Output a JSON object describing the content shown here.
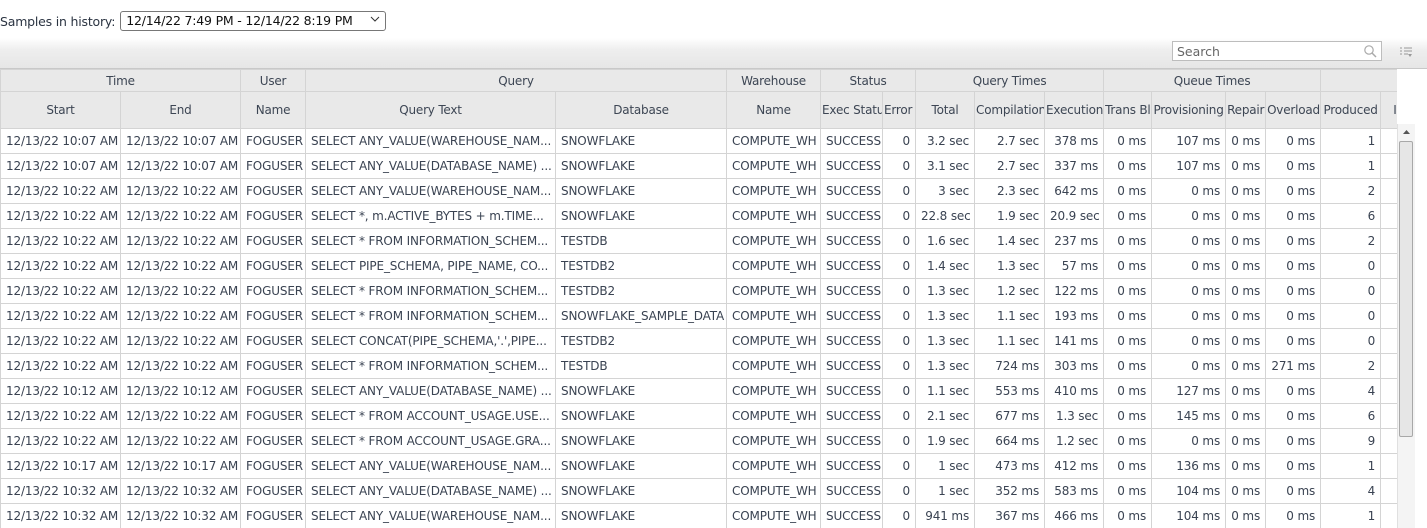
{
  "history": {
    "label": "Samples in history:",
    "selected": "12/14/22 7:49 PM - 12/14/22 8:19 PM"
  },
  "search": {
    "placeholder": "Search",
    "value": ""
  },
  "icons": {
    "search": "search-icon",
    "columns_menu": "column-chooser-icon",
    "dropdown": "chevron-down-icon",
    "scroll_up": "scroll-up-arrow-icon"
  },
  "grid": {
    "groups": [
      {
        "label": "Time",
        "span": 2
      },
      {
        "label": "User",
        "span": 1
      },
      {
        "label": "Query",
        "span": 2
      },
      {
        "label": "Warehouse",
        "span": 1
      },
      {
        "label": "Status",
        "span": 2
      },
      {
        "label": "Query Times",
        "span": 3
      },
      {
        "label": "Queue Times",
        "span": 4
      },
      {
        "label": "",
        "span": 2
      }
    ],
    "columns": [
      {
        "key": "start",
        "label": "Start",
        "align": "txt"
      },
      {
        "key": "end",
        "label": "End",
        "align": "txt"
      },
      {
        "key": "user",
        "label": "Name",
        "align": "txt"
      },
      {
        "key": "query",
        "label": "Query Text",
        "align": "txt"
      },
      {
        "key": "db",
        "label": "Database",
        "align": "txt"
      },
      {
        "key": "wh",
        "label": "Name",
        "align": "txt"
      },
      {
        "key": "exec",
        "label": "Exec Status",
        "align": "txt"
      },
      {
        "key": "err",
        "label": "Error Code",
        "align": "num"
      },
      {
        "key": "total",
        "label": "Total",
        "align": "num"
      },
      {
        "key": "comp",
        "label": "Compilation",
        "align": "num"
      },
      {
        "key": "execution",
        "label": "Execution",
        "align": "num"
      },
      {
        "key": "trans",
        "label": "Trans Blocked",
        "align": "num"
      },
      {
        "key": "prov",
        "label": "Provisioning",
        "align": "num"
      },
      {
        "key": "repair",
        "label": "Repair",
        "align": "num"
      },
      {
        "key": "overload",
        "label": "Overload",
        "align": "num"
      },
      {
        "key": "produced",
        "label": "Produced",
        "align": "num"
      },
      {
        "key": "ins",
        "label": "In:",
        "align": "num"
      }
    ],
    "rows": [
      {
        "start": "12/13/22 10:07 AM",
        "end": "12/13/22 10:07 AM",
        "user": "FOGUSER",
        "query": "SELECT ANY_VALUE(WAREHOUSE_NAM...",
        "db": "SNOWFLAKE",
        "wh": "COMPUTE_WH",
        "exec": "SUCCESS",
        "err": "0",
        "total": "3.2 sec",
        "comp": "2.7 sec",
        "execution": "378 ms",
        "trans": "0 ms",
        "prov": "107 ms",
        "repair": "0 ms",
        "overload": "0 ms",
        "produced": "1",
        "ins": ""
      },
      {
        "start": "12/13/22 10:07 AM",
        "end": "12/13/22 10:07 AM",
        "user": "FOGUSER",
        "query": "SELECT ANY_VALUE(DATABASE_NAME) ...",
        "db": "SNOWFLAKE",
        "wh": "COMPUTE_WH",
        "exec": "SUCCESS",
        "err": "0",
        "total": "3.1 sec",
        "comp": "2.7 sec",
        "execution": "337 ms",
        "trans": "0 ms",
        "prov": "107 ms",
        "repair": "0 ms",
        "overload": "0 ms",
        "produced": "1",
        "ins": ""
      },
      {
        "start": "12/13/22 10:22 AM",
        "end": "12/13/22 10:22 AM",
        "user": "FOGUSER",
        "query": "SELECT ANY_VALUE(WAREHOUSE_NAM...",
        "db": "SNOWFLAKE",
        "wh": "COMPUTE_WH",
        "exec": "SUCCESS",
        "err": "0",
        "total": "3 sec",
        "comp": "2.3 sec",
        "execution": "642 ms",
        "trans": "0 ms",
        "prov": "0 ms",
        "repair": "0 ms",
        "overload": "0 ms",
        "produced": "2",
        "ins": ""
      },
      {
        "start": "12/13/22 10:22 AM",
        "end": "12/13/22 10:22 AM",
        "user": "FOGUSER",
        "query": "SELECT *, m.ACTIVE_BYTES + m.TIME...",
        "db": "SNOWFLAKE",
        "wh": "COMPUTE_WH",
        "exec": "SUCCESS",
        "err": "0",
        "total": "22.8 sec",
        "comp": "1.9 sec",
        "execution": "20.9 sec",
        "trans": "0 ms",
        "prov": "0 ms",
        "repair": "0 ms",
        "overload": "0 ms",
        "produced": "6",
        "ins": ""
      },
      {
        "start": "12/13/22 10:22 AM",
        "end": "12/13/22 10:22 AM",
        "user": "FOGUSER",
        "query": "SELECT * FROM INFORMATION_SCHEM...",
        "db": "TESTDB",
        "wh": "COMPUTE_WH",
        "exec": "SUCCESS",
        "err": "0",
        "total": "1.6 sec",
        "comp": "1.4 sec",
        "execution": "237 ms",
        "trans": "0 ms",
        "prov": "0 ms",
        "repair": "0 ms",
        "overload": "0 ms",
        "produced": "2",
        "ins": ""
      },
      {
        "start": "12/13/22 10:22 AM",
        "end": "12/13/22 10:22 AM",
        "user": "FOGUSER",
        "query": "SELECT PIPE_SCHEMA, PIPE_NAME, CO...",
        "db": "TESTDB2",
        "wh": "COMPUTE_WH",
        "exec": "SUCCESS",
        "err": "0",
        "total": "1.4 sec",
        "comp": "1.3 sec",
        "execution": "57 ms",
        "trans": "0 ms",
        "prov": "0 ms",
        "repair": "0 ms",
        "overload": "0 ms",
        "produced": "0",
        "ins": ""
      },
      {
        "start": "12/13/22 10:22 AM",
        "end": "12/13/22 10:22 AM",
        "user": "FOGUSER",
        "query": "SELECT * FROM INFORMATION_SCHEM...",
        "db": "TESTDB2",
        "wh": "COMPUTE_WH",
        "exec": "SUCCESS",
        "err": "0",
        "total": "1.3 sec",
        "comp": "1.2 sec",
        "execution": "122 ms",
        "trans": "0 ms",
        "prov": "0 ms",
        "repair": "0 ms",
        "overload": "0 ms",
        "produced": "0",
        "ins": ""
      },
      {
        "start": "12/13/22 10:22 AM",
        "end": "12/13/22 10:22 AM",
        "user": "FOGUSER",
        "query": "SELECT * FROM INFORMATION_SCHEM...",
        "db": "SNOWFLAKE_SAMPLE_DATA",
        "wh": "COMPUTE_WH",
        "exec": "SUCCESS",
        "err": "0",
        "total": "1.3 sec",
        "comp": "1.1 sec",
        "execution": "193 ms",
        "trans": "0 ms",
        "prov": "0 ms",
        "repair": "0 ms",
        "overload": "0 ms",
        "produced": "0",
        "ins": ""
      },
      {
        "start": "12/13/22 10:22 AM",
        "end": "12/13/22 10:22 AM",
        "user": "FOGUSER",
        "query": "SELECT CONCAT(PIPE_SCHEMA,'.',PIPE...",
        "db": "TESTDB2",
        "wh": "COMPUTE_WH",
        "exec": "SUCCESS",
        "err": "0",
        "total": "1.3 sec",
        "comp": "1.1 sec",
        "execution": "141 ms",
        "trans": "0 ms",
        "prov": "0 ms",
        "repair": "0 ms",
        "overload": "0 ms",
        "produced": "0",
        "ins": ""
      },
      {
        "start": "12/13/22 10:22 AM",
        "end": "12/13/22 10:22 AM",
        "user": "FOGUSER",
        "query": "SELECT * FROM INFORMATION_SCHEM...",
        "db": "TESTDB",
        "wh": "COMPUTE_WH",
        "exec": "SUCCESS",
        "err": "0",
        "total": "1.3 sec",
        "comp": "724 ms",
        "execution": "303 ms",
        "trans": "0 ms",
        "prov": "0 ms",
        "repair": "0 ms",
        "overload": "271 ms",
        "produced": "2",
        "ins": ""
      },
      {
        "start": "12/13/22 10:12 AM",
        "end": "12/13/22 10:12 AM",
        "user": "FOGUSER",
        "query": "SELECT ANY_VALUE(DATABASE_NAME) ...",
        "db": "SNOWFLAKE",
        "wh": "COMPUTE_WH",
        "exec": "SUCCESS",
        "err": "0",
        "total": "1.1 sec",
        "comp": "553 ms",
        "execution": "410 ms",
        "trans": "0 ms",
        "prov": "127 ms",
        "repair": "0 ms",
        "overload": "0 ms",
        "produced": "4",
        "ins": ""
      },
      {
        "start": "12/13/22 10:22 AM",
        "end": "12/13/22 10:22 AM",
        "user": "FOGUSER",
        "query": "SELECT * FROM ACCOUNT_USAGE.USE...",
        "db": "SNOWFLAKE",
        "wh": "COMPUTE_WH",
        "exec": "SUCCESS",
        "err": "0",
        "total": "2.1 sec",
        "comp": "677 ms",
        "execution": "1.3 sec",
        "trans": "0 ms",
        "prov": "145 ms",
        "repair": "0 ms",
        "overload": "0 ms",
        "produced": "6",
        "ins": ""
      },
      {
        "start": "12/13/22 10:22 AM",
        "end": "12/13/22 10:22 AM",
        "user": "FOGUSER",
        "query": "SELECT * FROM ACCOUNT_USAGE.GRA...",
        "db": "SNOWFLAKE",
        "wh": "COMPUTE_WH",
        "exec": "SUCCESS",
        "err": "0",
        "total": "1.9 sec",
        "comp": "664 ms",
        "execution": "1.2 sec",
        "trans": "0 ms",
        "prov": "0 ms",
        "repair": "0 ms",
        "overload": "0 ms",
        "produced": "9",
        "ins": ""
      },
      {
        "start": "12/13/22 10:17 AM",
        "end": "12/13/22 10:17 AM",
        "user": "FOGUSER",
        "query": "SELECT ANY_VALUE(WAREHOUSE_NAM...",
        "db": "SNOWFLAKE",
        "wh": "COMPUTE_WH",
        "exec": "SUCCESS",
        "err": "0",
        "total": "1 sec",
        "comp": "473 ms",
        "execution": "412 ms",
        "trans": "0 ms",
        "prov": "136 ms",
        "repair": "0 ms",
        "overload": "0 ms",
        "produced": "1",
        "ins": ""
      },
      {
        "start": "12/13/22 10:32 AM",
        "end": "12/13/22 10:32 AM",
        "user": "FOGUSER",
        "query": "SELECT ANY_VALUE(DATABASE_NAME) ...",
        "db": "SNOWFLAKE",
        "wh": "COMPUTE_WH",
        "exec": "SUCCESS",
        "err": "0",
        "total": "1 sec",
        "comp": "352 ms",
        "execution": "583 ms",
        "trans": "0 ms",
        "prov": "104 ms",
        "repair": "0 ms",
        "overload": "0 ms",
        "produced": "4",
        "ins": ""
      },
      {
        "start": "12/13/22 10:32 AM",
        "end": "12/13/22 10:32 AM",
        "user": "FOGUSER",
        "query": "SELECT ANY_VALUE(WAREHOUSE_NAM...",
        "db": "SNOWFLAKE",
        "wh": "COMPUTE_WH",
        "exec": "SUCCESS",
        "err": "0",
        "total": "941 ms",
        "comp": "367 ms",
        "execution": "466 ms",
        "trans": "0 ms",
        "prov": "104 ms",
        "repair": "0 ms",
        "overload": "0 ms",
        "produced": "1",
        "ins": ""
      }
    ]
  }
}
